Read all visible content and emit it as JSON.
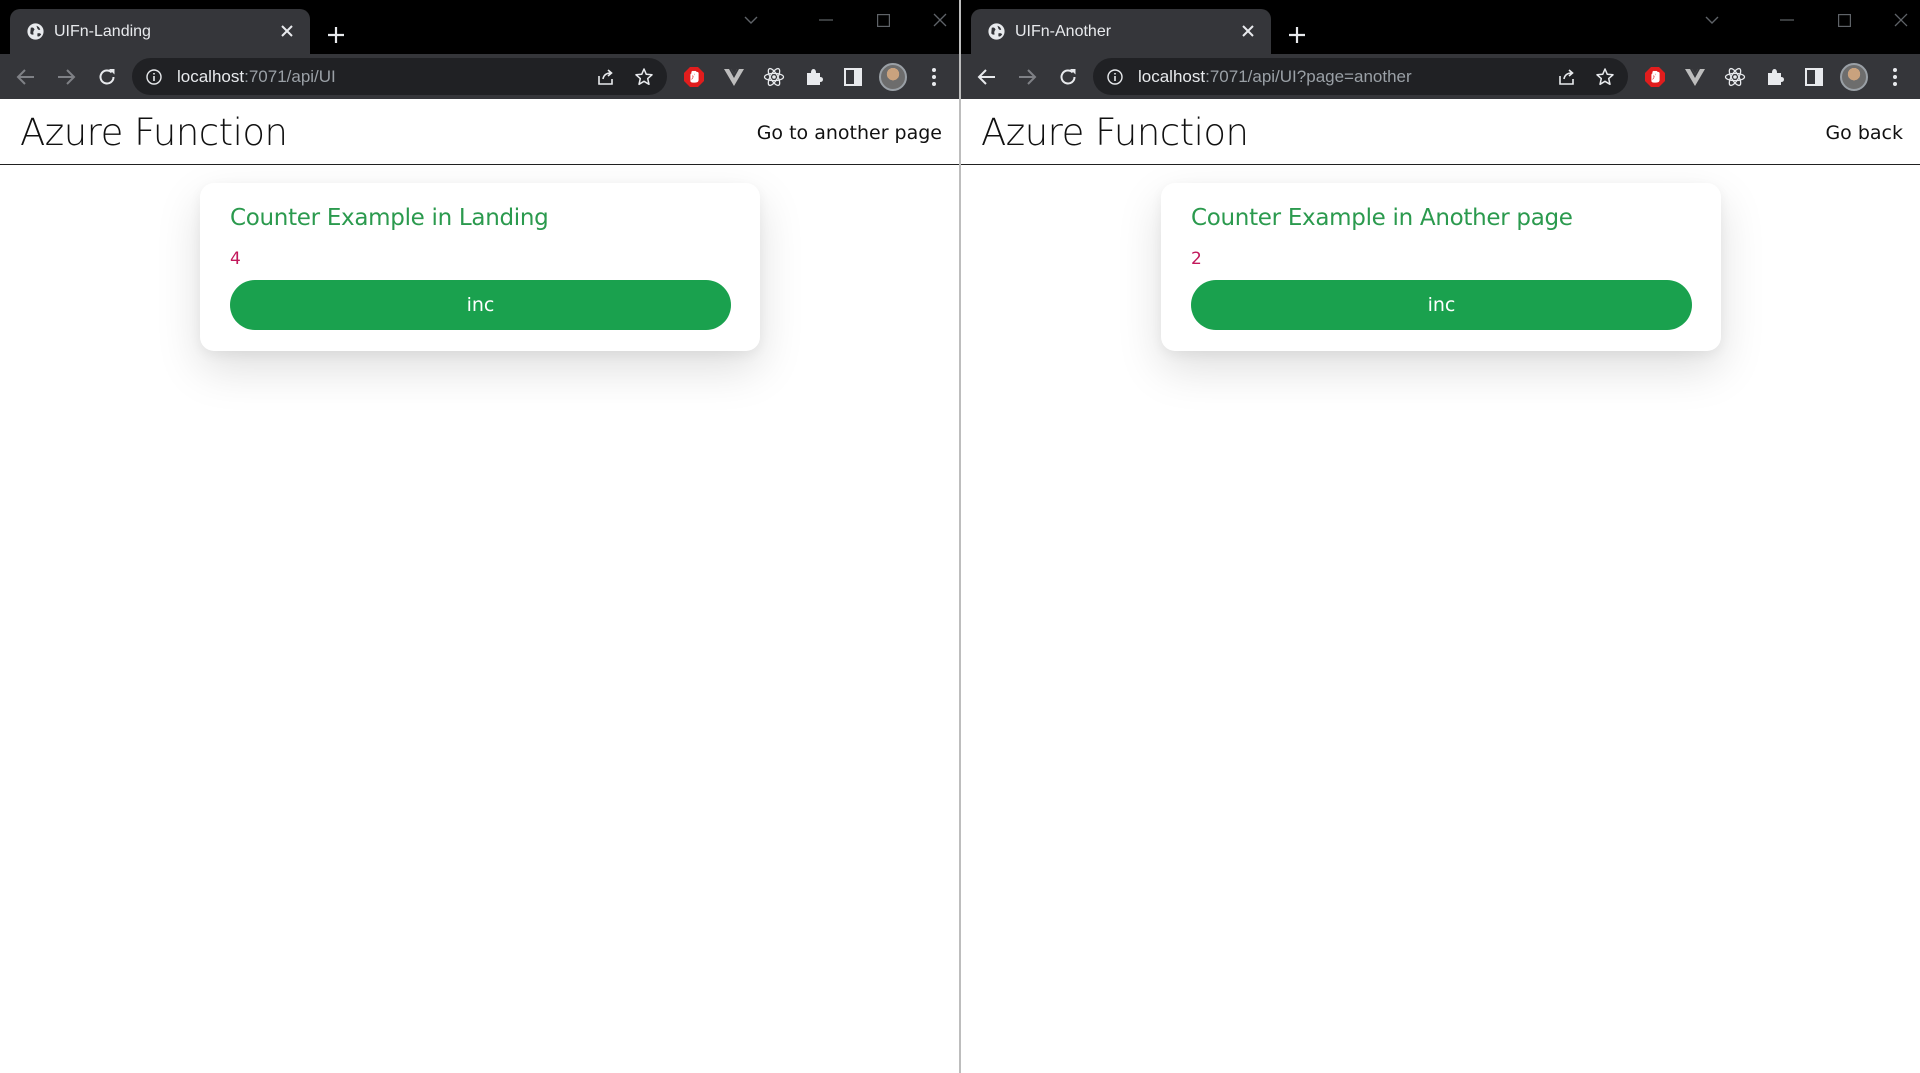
{
  "colors": {
    "titlebar": "#000000",
    "tab_active": "#35363a",
    "toolbar": "#35363a",
    "omnibox": "#202124",
    "card_title": "#2b9a4e",
    "counter_value": "#c2185b",
    "button_bg": "#1aa14e",
    "button_text": "#ffffff"
  },
  "windows": [
    {
      "tab": {
        "title": "UIFn-Landing",
        "favicon": "globe-icon"
      },
      "address": {
        "host": "localhost",
        "rest": ":7071/api/UI"
      },
      "page": {
        "title": "Azure Function",
        "nav_link": "Go to another page",
        "card": {
          "title": "Counter Example in Landing",
          "count": "4",
          "button": "inc"
        }
      }
    },
    {
      "tab": {
        "title": "UIFn-Another",
        "favicon": "globe-icon"
      },
      "address": {
        "host": "localhost",
        "rest": ":7071/api/UI?page=another"
      },
      "page": {
        "title": "Azure Function",
        "nav_link": "Go back",
        "card": {
          "title": "Counter Example in Another page",
          "count": "2",
          "button": "inc"
        }
      }
    }
  ],
  "toolbar_icons": [
    "back-icon",
    "forward-icon",
    "reload-icon",
    "share-icon",
    "star-icon",
    "adblock-icon",
    "vue-devtools-icon",
    "react-devtools-icon",
    "extensions-icon",
    "side-panel-icon",
    "profile-avatar",
    "menu-icon"
  ]
}
